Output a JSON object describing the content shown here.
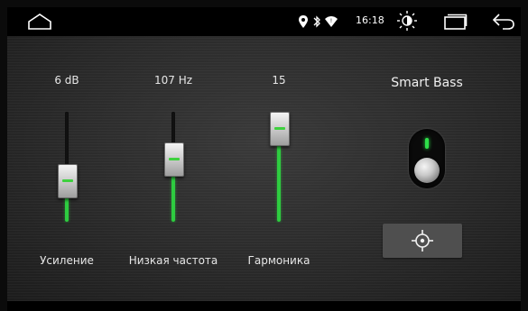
{
  "status_bar": {
    "time": "16:18",
    "icons": [
      "home-icon",
      "location-icon",
      "bluetooth-icon",
      "wifi-icon",
      "brightness-icon",
      "recents-icon",
      "back-icon"
    ]
  },
  "equalizer": {
    "accent_color": "#2ecc40",
    "sliders": [
      {
        "value_label": "6 dB",
        "name": "Усиление",
        "level": 0.33
      },
      {
        "value_label": "107 Hz",
        "name": "Низкая частота",
        "level": 0.6
      },
      {
        "value_label": "15",
        "name": "Гармоника",
        "level": 1.0
      }
    ]
  },
  "smart_bass": {
    "label": "Smart Bass",
    "enabled": true,
    "button_icon": "target-icon"
  }
}
